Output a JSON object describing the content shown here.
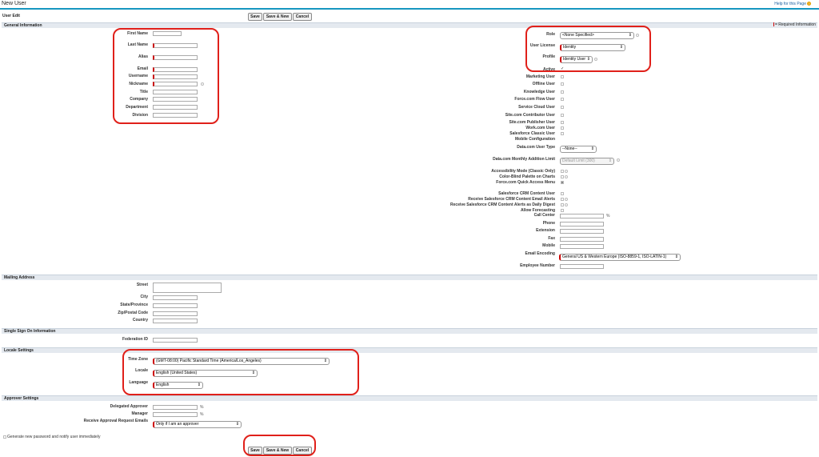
{
  "page": {
    "title": "New User",
    "help_link": "Help for this Page",
    "section_bar": "User Edit"
  },
  "buttons": {
    "save": "Save",
    "save_new": "Save & New",
    "cancel": "Cancel"
  },
  "required_info": "= Required Information",
  "sections": {
    "general": "General Information",
    "mailing": "Mailing Address",
    "sso": "Single Sign On Information",
    "locale": "Locale Settings",
    "approver": "Approver Settings"
  },
  "general_left": {
    "first_name": "First Name",
    "last_name": "Last Name",
    "alias": "Alias",
    "email": "Email",
    "username": "Username",
    "nickname": "Nickname",
    "title": "Title",
    "company": "Company",
    "department": "Department",
    "division": "Division"
  },
  "general_right": {
    "role": {
      "label": "Role",
      "value": "<None Specified>"
    },
    "user_license": {
      "label": "User License",
      "value": "Identity"
    },
    "profile": {
      "label": "Profile",
      "value": "Identity User"
    },
    "active": "Active",
    "marketing_user": "Marketing User",
    "offline_user": "Offline User",
    "knowledge_user": "Knowledge User",
    "flow_user": "Force.com Flow User",
    "service_cloud_user": "Service Cloud User",
    "site_contributor": "Site.com Contributor User",
    "site_publisher": "Site.com Publisher User",
    "work_user": "Work.com User",
    "sf_classic_user": "Salesforce Classic User",
    "mobile_config": "Mobile Configuration",
    "datacom_user_type": {
      "label": "Data.com User Type",
      "value": "--None--"
    },
    "datacom_limit": {
      "label": "Data.com Monthly Addition Limit",
      "value": "Default Limit (300)"
    },
    "accessibility": "Accessibility Mode (Classic Only)",
    "color_blind": "Color-Blind Palette on Charts",
    "quick_access": "Force.com Quick Access Menu",
    "crm_content_user": "Salesforce CRM Content User",
    "crm_alerts": "Receive Salesforce CRM Content Email Alerts",
    "crm_digest": "Receive Salesforce CRM Content Alerts as Daily Digest",
    "allow_forecasting": "Allow Forecasting",
    "call_center": "Call Center",
    "phone": "Phone",
    "extension": "Extension",
    "fax": "Fax",
    "mobile": "Mobile",
    "email_encoding": {
      "label": "Email Encoding",
      "value": "General US & Western Europe (ISO-8859-1, ISO-LATIN-1)"
    },
    "employee_number": "Employee Number"
  },
  "mailing": {
    "street": "Street",
    "city": "City",
    "state": "State/Province",
    "zip": "Zip/Postal Code",
    "country": "Country"
  },
  "sso": {
    "federation_id": "Federation ID"
  },
  "locale": {
    "time_zone": {
      "label": "Time Zone",
      "value": "(GMT-08:00) Pacific Standard Time (America/Los_Angeles)"
    },
    "locale": {
      "label": "Locale",
      "value": "English (United States)"
    },
    "language": {
      "label": "Language",
      "value": "English"
    }
  },
  "approver": {
    "delegated": "Delegated Approver",
    "manager": "Manager",
    "receive_emails": {
      "label": "Receive Approval Request Emails",
      "value": "Only if I am an approver"
    }
  },
  "generate_password": "Generate new password and notify user immediately",
  "colors": {
    "highlight": "#e0201a",
    "header_line": "#1797c0",
    "required": "#cc0000",
    "section_bg": "#e4e9ef"
  }
}
